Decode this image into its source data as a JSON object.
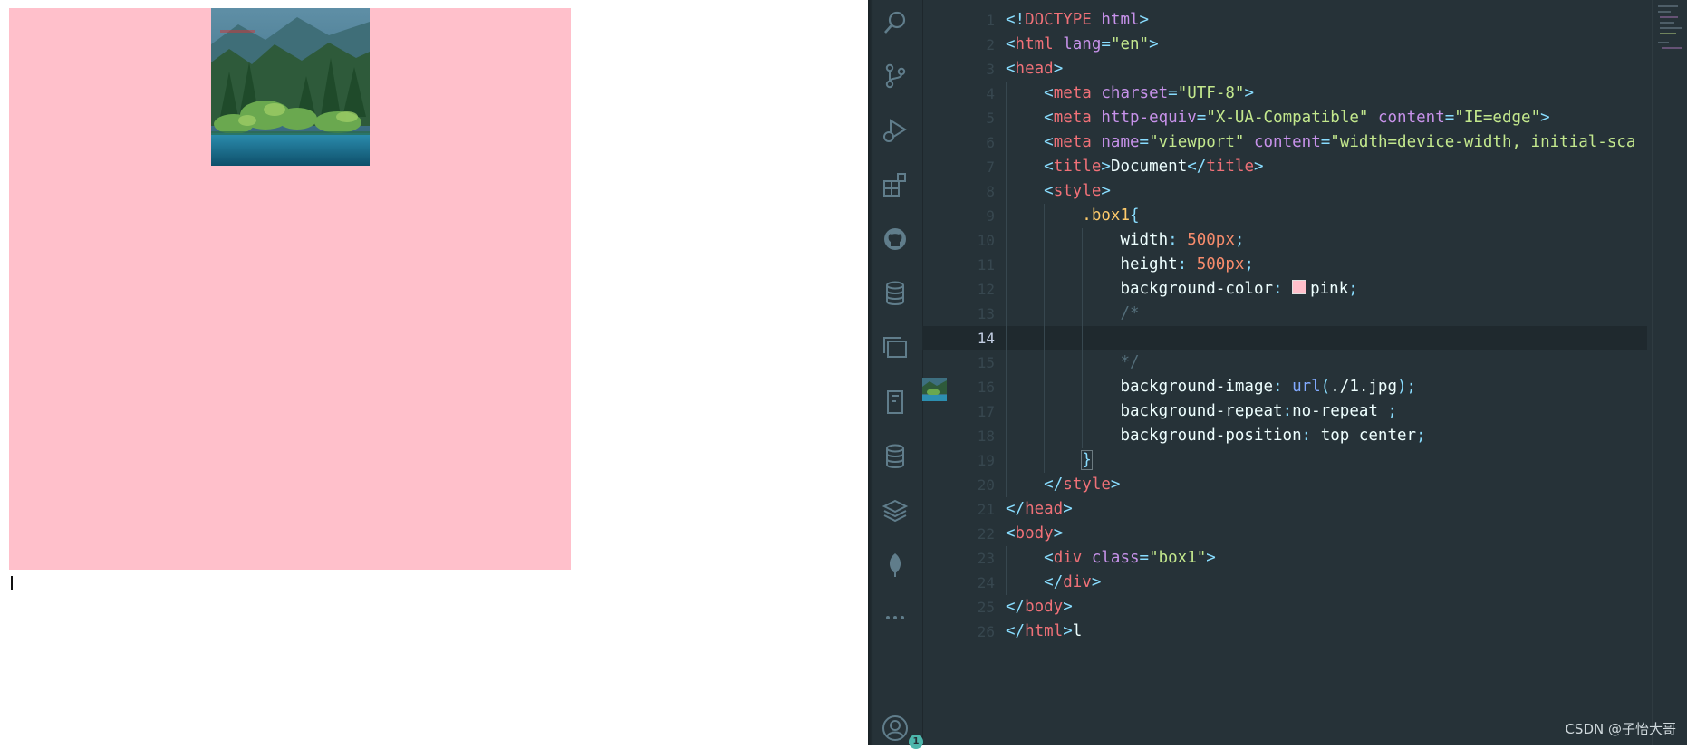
{
  "preview": {
    "box_color": "#ffc0cb",
    "image_description_icon": "forest-lake-photo"
  },
  "activity_bar": {
    "icons": [
      "search-icon",
      "source-control-icon",
      "run-debug-icon",
      "extensions-icon",
      "github-icon",
      "database-icon",
      "panels-icon",
      "bookmark-icon",
      "database-icon",
      "layers-icon",
      "leaf-icon",
      "more-icon",
      "account-icon"
    ],
    "account_badge": "1"
  },
  "editor": {
    "active_line": 14,
    "line_numbers": [
      "1",
      "2",
      "3",
      "4",
      "5",
      "6",
      "7",
      "8",
      "9",
      "10",
      "11",
      "12",
      "13",
      "14",
      "15",
      "16",
      "17",
      "18",
      "19",
      "20",
      "21",
      "22",
      "23",
      "24",
      "25",
      "26"
    ],
    "lines": [
      [
        [
          "<!",
          "tag"
        ],
        [
          "DOCTYPE",
          "name"
        ],
        [
          " html",
          "attr"
        ],
        [
          ">",
          "tag"
        ]
      ],
      [
        [
          "<",
          "tag"
        ],
        [
          "html",
          "name"
        ],
        [
          " lang",
          "attr"
        ],
        [
          "=",
          "tag"
        ],
        [
          "\"en\"",
          "str"
        ],
        [
          ">",
          "tag"
        ]
      ],
      [
        [
          "<",
          "tag"
        ],
        [
          "head",
          "name"
        ],
        [
          ">",
          "tag"
        ]
      ],
      [
        [
          "    ",
          "txt"
        ],
        [
          "<",
          "tag"
        ],
        [
          "meta",
          "name"
        ],
        [
          " charset",
          "attr"
        ],
        [
          "=",
          "tag"
        ],
        [
          "\"UTF-8\"",
          "str"
        ],
        [
          ">",
          "tag"
        ]
      ],
      [
        [
          "    ",
          "txt"
        ],
        [
          "<",
          "tag"
        ],
        [
          "meta",
          "name"
        ],
        [
          " http-equiv",
          "attr"
        ],
        [
          "=",
          "tag"
        ],
        [
          "\"X-UA-Compatible\"",
          "str"
        ],
        [
          " content",
          "attr"
        ],
        [
          "=",
          "tag"
        ],
        [
          "\"IE=edge\"",
          "str"
        ],
        [
          ">",
          "tag"
        ]
      ],
      [
        [
          "    ",
          "txt"
        ],
        [
          "<",
          "tag"
        ],
        [
          "meta",
          "name"
        ],
        [
          " name",
          "attr"
        ],
        [
          "=",
          "tag"
        ],
        [
          "\"viewport\"",
          "str"
        ],
        [
          " content",
          "attr"
        ],
        [
          "=",
          "tag"
        ],
        [
          "\"width=device-width, initial-sca",
          "str"
        ]
      ],
      [
        [
          "    ",
          "txt"
        ],
        [
          "<",
          "tag"
        ],
        [
          "title",
          "name"
        ],
        [
          ">",
          "tag"
        ],
        [
          "Document",
          "txt"
        ],
        [
          "</",
          "tag"
        ],
        [
          "title",
          "name"
        ],
        [
          ">",
          "tag"
        ]
      ],
      [
        [
          "    ",
          "txt"
        ],
        [
          "<",
          "tag"
        ],
        [
          "style",
          "name"
        ],
        [
          ">",
          "tag"
        ]
      ],
      [
        [
          "        ",
          "txt"
        ],
        [
          ".box1",
          "sel"
        ],
        [
          "{",
          "tag"
        ]
      ],
      [
        [
          "            ",
          "txt"
        ],
        [
          "width",
          "txt"
        ],
        [
          ": ",
          "tag"
        ],
        [
          "500px",
          "num"
        ],
        [
          ";",
          "tag"
        ]
      ],
      [
        [
          "            ",
          "txt"
        ],
        [
          "height",
          "txt"
        ],
        [
          ": ",
          "tag"
        ],
        [
          "500px",
          "num"
        ],
        [
          ";",
          "tag"
        ]
      ],
      [
        [
          "            ",
          "txt"
        ],
        [
          "background-color",
          "txt"
        ],
        [
          ": ",
          "tag"
        ],
        [
          "pink",
          "txt"
        ],
        [
          ";",
          "tag"
        ]
      ],
      [
        [
          "            ",
          "txt"
        ],
        [
          "/*",
          "com"
        ]
      ],
      [
        [
          "",
          "txt"
        ]
      ],
      [
        [
          "            ",
          "txt"
        ],
        [
          "*/",
          "com"
        ]
      ],
      [
        [
          "            ",
          "txt"
        ],
        [
          "background-image",
          "txt"
        ],
        [
          ": ",
          "tag"
        ],
        [
          "url",
          "fn"
        ],
        [
          "(",
          "tag"
        ],
        [
          "./1.jpg",
          "txt"
        ],
        [
          ");",
          "tag"
        ]
      ],
      [
        [
          "            ",
          "txt"
        ],
        [
          "background-repeat",
          "txt"
        ],
        [
          ":",
          "tag"
        ],
        [
          "no-repeat ",
          "txt"
        ],
        [
          ";",
          "tag"
        ]
      ],
      [
        [
          "            ",
          "txt"
        ],
        [
          "background-position",
          "txt"
        ],
        [
          ": ",
          "tag"
        ],
        [
          "top center",
          "txt"
        ],
        [
          ";",
          "tag"
        ]
      ],
      [
        [
          "        ",
          "txt"
        ],
        [
          "}",
          "tag"
        ]
      ],
      [
        [
          "    ",
          "txt"
        ],
        [
          "</",
          "tag"
        ],
        [
          "style",
          "name"
        ],
        [
          ">",
          "tag"
        ]
      ],
      [
        [
          "</",
          "tag"
        ],
        [
          "head",
          "name"
        ],
        [
          ">",
          "tag"
        ]
      ],
      [
        [
          "<",
          "tag"
        ],
        [
          "body",
          "name"
        ],
        [
          ">",
          "tag"
        ]
      ],
      [
        [
          "    ",
          "txt"
        ],
        [
          "<",
          "tag"
        ],
        [
          "div",
          "name"
        ],
        [
          " class",
          "attr"
        ],
        [
          "=",
          "tag"
        ],
        [
          "\"box1\"",
          "str"
        ],
        [
          ">",
          "tag"
        ]
      ],
      [
        [
          "    ",
          "txt"
        ],
        [
          "</",
          "tag"
        ],
        [
          "div",
          "name"
        ],
        [
          ">",
          "tag"
        ]
      ],
      [
        [
          "</",
          "tag"
        ],
        [
          "body",
          "name"
        ],
        [
          ">",
          "tag"
        ]
      ],
      [
        [
          "</",
          "tag"
        ],
        [
          "html",
          "name"
        ],
        [
          ">",
          "tag"
        ],
        [
          "l",
          "txt"
        ]
      ]
    ],
    "swatch_color": "#ffc0cb",
    "thumb_icon": "image-preview-icon"
  },
  "watermark": "CSDN @子怡大哥"
}
